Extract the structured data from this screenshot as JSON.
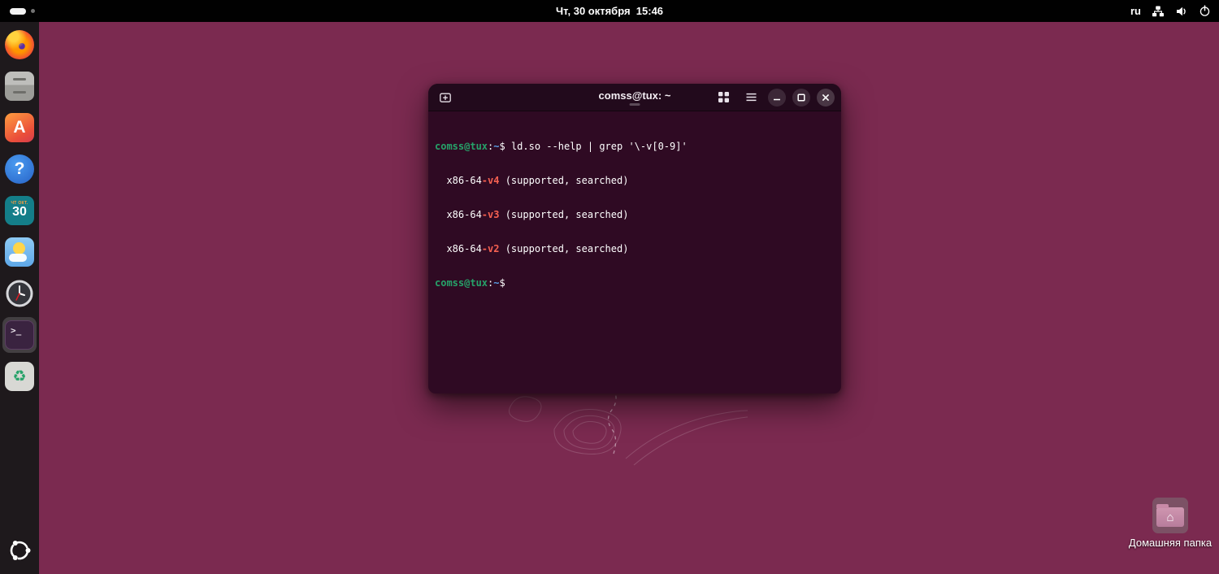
{
  "topbar": {
    "clock": "Чт, 30 октября  15:46",
    "keyboard_layout": "ru"
  },
  "dock": {
    "app_center_glyph": "A",
    "help_glyph": "?",
    "calendar_header": "чт окт.",
    "calendar_day": "30",
    "terminal_glyph": ">_",
    "trash_glyph": "♻"
  },
  "terminal": {
    "title": "comss@tux: ~",
    "prompt": {
      "user": "comss@tux",
      "separator": ":",
      "path": "~",
      "symbol": "$ "
    },
    "command": "ld.so --help | grep '\\-v[0-9]'",
    "output": [
      {
        "pre": "  x86-64",
        "match": "-v4",
        "post": " (supported, searched)"
      },
      {
        "pre": "  x86-64",
        "match": "-v3",
        "post": " (supported, searched)"
      },
      {
        "pre": "  x86-64",
        "match": "-v2",
        "post": " (supported, searched)"
      }
    ]
  },
  "desktop": {
    "home_folder_label": "Домашняя папка",
    "home_glyph": "⌂"
  }
}
